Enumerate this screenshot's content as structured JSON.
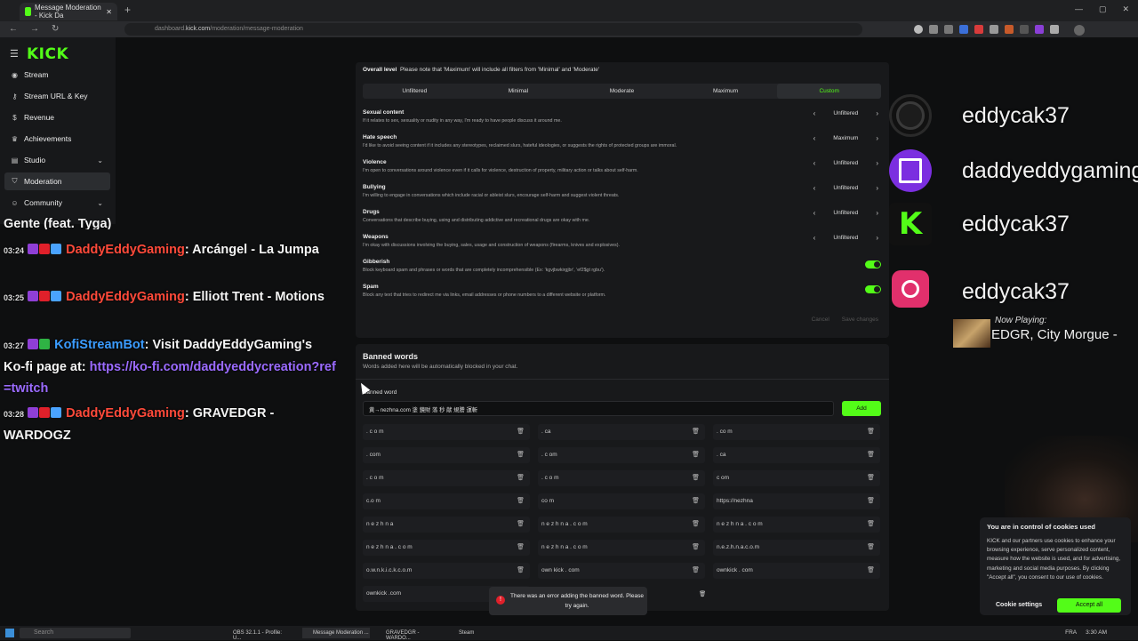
{
  "browser": {
    "tab_title": "Message Moderation - Kick Da",
    "url_prefix": "dashboard.",
    "url_domain": "kick.com",
    "url_path": "/moderation/message-moderation"
  },
  "sidebar": {
    "logo": "KICK",
    "items": [
      {
        "label": "Stream",
        "icon": "stream-icon"
      },
      {
        "label": "Stream URL & Key",
        "icon": "key-icon"
      },
      {
        "label": "Revenue",
        "icon": "revenue-icon"
      },
      {
        "label": "Achievements",
        "icon": "trophy-icon"
      },
      {
        "label": "Studio",
        "icon": "studio-icon"
      },
      {
        "label": "Moderation",
        "icon": "shield-icon"
      },
      {
        "label": "Community",
        "icon": "community-icon"
      }
    ]
  },
  "chat": {
    "partial_line": "Gente (feat. Tyga)",
    "messages": [
      {
        "time": "03:24",
        "user": "DaddyEddyGaming",
        "text": ": Arcángel - La Jumpa"
      },
      {
        "time": "03:25",
        "user": "DaddyEddyGaming",
        "text": ": Elliott Trent - Motions"
      },
      {
        "time": "03:27",
        "user": "KofiStreamBot",
        "text": ": Visit DaddyEddyGaming's Ko-fi page at: ",
        "link": "https://ko-fi.com/daddyeddycreation?ref=twitch"
      },
      {
        "time": "03:28",
        "user": "DaddyEddyGaming",
        "text": ": GRAVEDGR - WARDOGZ"
      }
    ]
  },
  "moderation": {
    "overall_label": "Overall level",
    "overall_note": "Please note that 'Maximum' will include all filters from 'Minimal' and 'Moderate'",
    "levels": [
      "Unfiltered",
      "Minimal",
      "Moderate",
      "Maximum",
      "Custom"
    ],
    "selected_level": "Custom",
    "filters": [
      {
        "title": "Sexual content",
        "desc": "If it relates to sex, sexuality or nudity in any way, I'm ready to have people discuss it around me.",
        "value": "Unfiltered"
      },
      {
        "title": "Hate speech",
        "desc": "I'd like to avoid seeing content if it includes any stereotypes, reclaimed slurs, hateful ideologies, or suggests the rights of protected groups are immoral.",
        "value": "Maximum"
      },
      {
        "title": "Violence",
        "desc": "I'm open to conversations around violence even if it calls for violence, destruction of property, military action or talks about self-harm.",
        "value": "Unfiltered"
      },
      {
        "title": "Bullying",
        "desc": "I'm willing to engage in conversations which include racial or ableist slurs, encourage self-harm and suggest violent threats.",
        "value": "Unfiltered"
      },
      {
        "title": "Drugs",
        "desc": "Conversations that describe buying, using and distributing addictive and recreational drugs are okay with me.",
        "value": "Unfiltered"
      },
      {
        "title": "Weapons",
        "desc": "I'm okay with discussions involving the buying, sales, usage and construction of weapons (firearms, knives and explosives).",
        "value": "Unfiltered"
      }
    ],
    "toggles": [
      {
        "title": "Gibberish",
        "desc": "Block keyboard spam and phrases or words that are completely incomprehensible (Ex: 'kgvjbwkirgjbr', 'ef2$gt rgbu').",
        "on": true
      },
      {
        "title": "Spam",
        "desc": "Block any text that tries to redirect me via links, email addresses or phone numbers to a different website or platform.",
        "on": true
      }
    ],
    "cancel_label": "Cancel",
    "save_label": "Save changes"
  },
  "banned": {
    "title": "Banned words",
    "desc": "Words added here will be automatically blocked in your chat.",
    "input_label": "Banned word",
    "input_value": "黄→nezhna.com 塗 鏡財 落 秒 献 規謄 運斬",
    "add_label": "Add",
    "words": [
      ". c o m",
      ". ca",
      ". co m",
      ". com",
      ". c om",
      ". ca",
      ". c o m",
      ". c o m",
      "c om",
      "c.o m",
      "co m",
      "https://nezhna",
      "n e z h n a",
      "n e z h n a . c o m",
      "n e z h n a . c o m",
      "n e z h n a . c o m",
      "n e z h n a . c o m",
      "n.e.z.h.n.a.c.o.m",
      "o.w.n.k.i.c.k.c.o.m",
      "own kick . com",
      "ownkick . com",
      "ownkick .com",
      "",
      ""
    ],
    "error_text": "There was an error adding the banned word. Please try again."
  },
  "socials": [
    {
      "icon": "github-icon",
      "handle": "eddycak37"
    },
    {
      "icon": "twitch-icon",
      "handle": "daddyeddygaming"
    },
    {
      "icon": "kick-icon",
      "handle": "eddycak37"
    },
    {
      "icon": "instagram-icon",
      "handle": "eddycak37"
    }
  ],
  "now_playing": {
    "label": "Now Playing:",
    "title": "EDGR, City Morgue -"
  },
  "cookies": {
    "title": "You are in control of cookies used",
    "body": "KICK and our partners use cookies to enhance your browsing experience, serve personalized content, measure how the website is used, and for advertising, marketing and social media purposes. By clicking \"Accept all\", you consent to our use of cookies.",
    "settings_label": "Cookie settings",
    "accept_label": "Accept all"
  },
  "taskbar": {
    "search": "Search",
    "apps": [
      "OBS 32.1.1 - Profile: U...",
      "Message Moderation ...",
      "GRAVEDGR - WARDO...",
      "Steam"
    ],
    "lang": "FRA",
    "time": "3:30 AM"
  },
  "colors": {
    "accent": "#53fc18",
    "panel": "#18191b",
    "error": "#e0202a"
  }
}
